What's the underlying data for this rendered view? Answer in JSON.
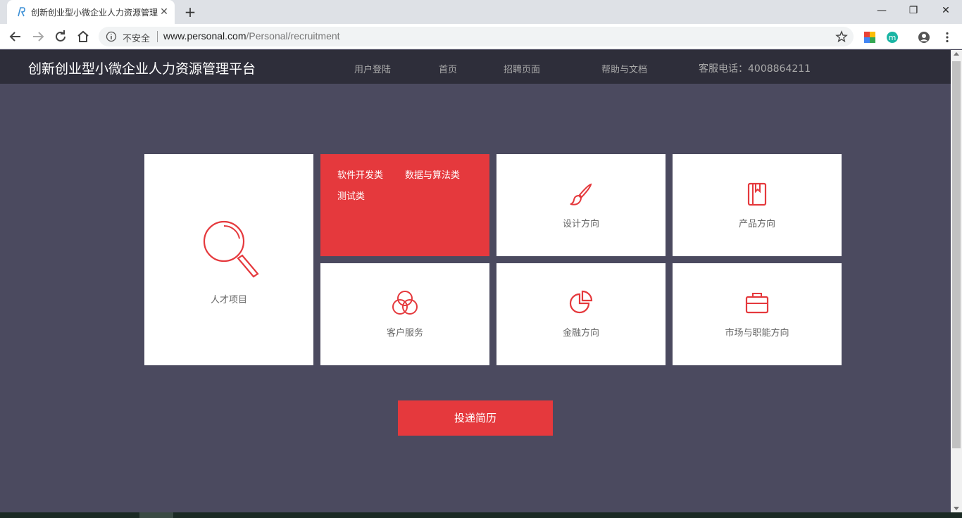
{
  "browser": {
    "tab_title": "创新创业型小微企业人力资源管理平台",
    "tab_close": "✕",
    "new_tab": "+",
    "window_controls": {
      "minimize": "—",
      "restore": "❐",
      "close": "✕"
    },
    "omnibox": {
      "security_label": "不安全",
      "url_host": "www.personal.com",
      "url_path": "/Personal/recruitment"
    },
    "extension_letter": "m"
  },
  "header": {
    "title": "创新创业型小微企业人力资源管理平台",
    "nav": [
      {
        "label": "用户登陆"
      },
      {
        "label": "首页"
      },
      {
        "label": "招聘页面"
      },
      {
        "label": "帮助与文档"
      }
    ],
    "hotline": "客服电话：4008864211"
  },
  "categories": {
    "talent": {
      "label": "人才项目",
      "icon": "magnifier-icon"
    },
    "tech": {
      "links": [
        {
          "label": "软件开发类"
        },
        {
          "label": "数据与算法类"
        },
        {
          "label": "测试类"
        }
      ]
    },
    "design": {
      "label": "设计方向",
      "icon": "brush-icon"
    },
    "product": {
      "label": "产品方向",
      "icon": "notebook-icon"
    },
    "service": {
      "label": "客户服务",
      "icon": "circles-icon"
    },
    "finance": {
      "label": "金融方向",
      "icon": "pie-chart-icon"
    },
    "market": {
      "label": "市场与职能方向",
      "icon": "briefcase-icon"
    }
  },
  "apply_button": "投递简历",
  "colors": {
    "accent": "#e5393d",
    "header_bg": "#2e2e3a",
    "page_bg": "#4b4a5f"
  }
}
